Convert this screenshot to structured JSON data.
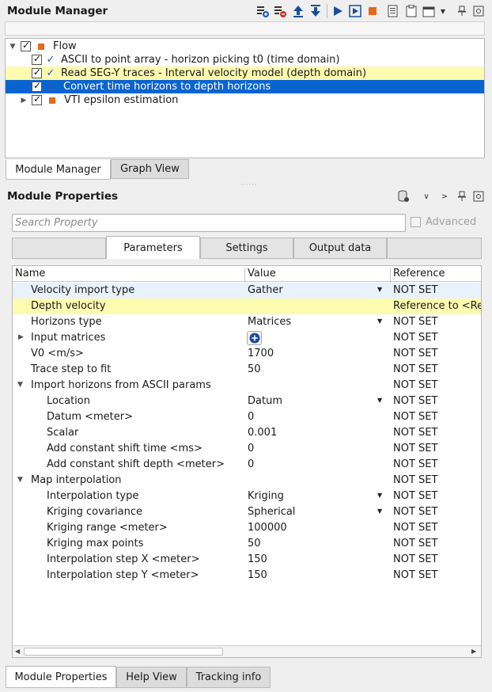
{
  "module_manager": {
    "title": "Module Manager",
    "tree": [
      {
        "label": "Flow",
        "level": 0,
        "icon": "orange-square",
        "checked": true,
        "expanded": true
      },
      {
        "label": "ASCII to point array - horizon picking t0 (time domain)",
        "level": 1,
        "icon": "blue-check",
        "checked": true
      },
      {
        "label": "Read SEG-Y traces - Interval velocity model (depth domain)",
        "level": 1,
        "icon": "blue-check",
        "checked": true,
        "state": "highlighted"
      },
      {
        "label": "Convert time horizons to depth horizons",
        "level": 1,
        "icon": "blue-square",
        "checked": true,
        "state": "selected"
      },
      {
        "label": "VTI epsilon estimation",
        "level": 1,
        "icon": "orange-square",
        "checked": true,
        "collapsed": true
      }
    ],
    "tabs": [
      "Module Manager",
      "Graph View"
    ]
  },
  "module_properties": {
    "title": "Module Properties",
    "search_placeholder": "Search Property",
    "advanced_label": "Advanced",
    "tabs": [
      "",
      "Parameters",
      "Settings",
      "Output data",
      ""
    ],
    "columns": [
      "Name",
      "Value",
      "Reference"
    ],
    "rows": [
      {
        "name": "Velocity import type",
        "value": "Gather",
        "ref": "NOT SET",
        "indent": 1,
        "dropdown": true,
        "state": "hover"
      },
      {
        "name": "Depth velocity",
        "value": "",
        "ref": "Reference to <Re",
        "indent": 1,
        "state": "highlighted"
      },
      {
        "name": "Horizons type",
        "value": "Matrices",
        "ref": "NOT SET",
        "indent": 1,
        "dropdown": true
      },
      {
        "name": "Input matrices",
        "value": "",
        "ref": "NOT SET",
        "indent": 1,
        "expander": "collapsed",
        "add_button": true
      },
      {
        "name": "V0 <m/s>",
        "value": "1700",
        "ref": "NOT SET",
        "indent": 1
      },
      {
        "name": "Trace step to fit",
        "value": "50",
        "ref": "NOT SET",
        "indent": 1
      },
      {
        "name": "Import horizons from ASCII params",
        "value": "",
        "ref": "NOT SET",
        "indent": 1,
        "expander": "expanded"
      },
      {
        "name": "Location",
        "value": "Datum",
        "ref": "NOT SET",
        "indent": 2,
        "dropdown": true
      },
      {
        "name": "Datum <meter>",
        "value": "0",
        "ref": "NOT SET",
        "indent": 2
      },
      {
        "name": "Scalar",
        "value": "0.001",
        "ref": "NOT SET",
        "indent": 2
      },
      {
        "name": "Add constant shift time <ms>",
        "value": "0",
        "ref": "NOT SET",
        "indent": 2
      },
      {
        "name": "Add constant shift depth <meter>",
        "value": "0",
        "ref": "NOT SET",
        "indent": 2
      },
      {
        "name": "Map interpolation",
        "value": "",
        "ref": "NOT SET",
        "indent": 1,
        "expander": "expanded"
      },
      {
        "name": "Interpolation type",
        "value": "Kriging",
        "ref": "NOT SET",
        "indent": 2,
        "dropdown": true
      },
      {
        "name": "Kriging covariance",
        "value": "Spherical",
        "ref": "NOT SET",
        "indent": 2,
        "dropdown": true
      },
      {
        "name": "Kriging range <meter>",
        "value": "100000",
        "ref": "NOT SET",
        "indent": 2
      },
      {
        "name": "Kriging max points",
        "value": "50",
        "ref": "NOT SET",
        "indent": 2
      },
      {
        "name": "Interpolation step X <meter>",
        "value": "150",
        "ref": "NOT SET",
        "indent": 2
      },
      {
        "name": "Interpolation step Y <meter>",
        "value": "150",
        "ref": "NOT SET",
        "indent": 2
      }
    ],
    "bottom_tabs": [
      "Module Properties",
      "Help View",
      "Tracking info"
    ]
  },
  "colors": {
    "selection": "#0a64d0",
    "highlight": "#fdfbb0",
    "hover": "#e8f2fd",
    "orange": "#e56a1b",
    "blue": "#1a5ec2"
  }
}
